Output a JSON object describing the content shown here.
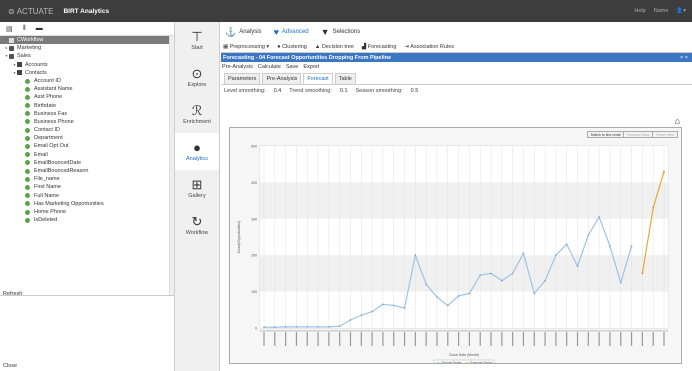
{
  "app": {
    "logo": "ACTUATE",
    "title": "BIRT Analytics",
    "help": "Help",
    "user": "Name"
  },
  "tree": [
    {
      "label": "CWorkflow",
      "level": 0,
      "type": "root",
      "selected": true
    },
    {
      "label": "Marketing",
      "level": 0,
      "type": "db"
    },
    {
      "label": "Sales",
      "level": 0,
      "type": "db"
    },
    {
      "label": "Accounts",
      "level": 1,
      "type": "table"
    },
    {
      "label": "Contacts",
      "level": 1,
      "type": "table"
    },
    {
      "label": "Account ID",
      "level": 2,
      "type": "field"
    },
    {
      "label": "Assistant Name",
      "level": 2,
      "type": "field"
    },
    {
      "label": "Asst Phone",
      "level": 2,
      "type": "field"
    },
    {
      "label": "Birthdate",
      "level": 2,
      "type": "field"
    },
    {
      "label": "Business Fax",
      "level": 2,
      "type": "field"
    },
    {
      "label": "Business Phone",
      "level": 2,
      "type": "field"
    },
    {
      "label": "Contact ID",
      "level": 2,
      "type": "field"
    },
    {
      "label": "Department",
      "level": 2,
      "type": "field"
    },
    {
      "label": "Email Opt Out",
      "level": 2,
      "type": "field"
    },
    {
      "label": "Email",
      "level": 2,
      "type": "field"
    },
    {
      "label": "EmailBouncedDate",
      "level": 2,
      "type": "field"
    },
    {
      "label": "EmailBouncedReason",
      "level": 2,
      "type": "field"
    },
    {
      "label": "File_name",
      "level": 2,
      "type": "field"
    },
    {
      "label": "First Name",
      "level": 2,
      "type": "field"
    },
    {
      "label": "Full Name",
      "level": 2,
      "type": "field"
    },
    {
      "label": "Has Marketing Opportunities",
      "level": 2,
      "type": "field"
    },
    {
      "label": "Home Phone",
      "level": 2,
      "type": "field"
    },
    {
      "label": "IsDeleted",
      "level": 2,
      "type": "field"
    }
  ],
  "left_footer": {
    "refresh": "Refresh",
    "close": "Close"
  },
  "nav": [
    {
      "label": "Start",
      "glyph": "⊤"
    },
    {
      "label": "Explore",
      "glyph": "⊙"
    },
    {
      "label": "Enrichment",
      "glyph": "ℛ"
    },
    {
      "label": "Analytics",
      "glyph": "●",
      "active": true
    },
    {
      "label": "Gallery",
      "glyph": "⊞"
    },
    {
      "label": "Workflow",
      "glyph": "↻"
    }
  ],
  "top_tabs": {
    "analysis": "Analysis",
    "advanced": "Advanced",
    "selections": "Selections"
  },
  "sub_tabs": {
    "preprocessing": "Preprocessing",
    "clustering": "Clustering",
    "decision_tree": "Decision tree",
    "forecasting": "Forecasting",
    "association": "Association Rules"
  },
  "panel_title": "Forecasting - 04 Forecast Opportunities Dropping From Pipeline",
  "panel_close": "× ×",
  "menu": {
    "preanalysis": "Pre-Analysis",
    "calculate": "Calculate",
    "save": "Save",
    "export": "Export"
  },
  "inner_tabs": {
    "parameters": "Parameters",
    "preanalysis": "Pre-Analysis",
    "forecast": "Forecast",
    "table": "Table"
  },
  "smoothing": {
    "level_label": "Level smoothing:",
    "level": "0.4",
    "trend_label": "Trend smoothing:",
    "trend": "0.1",
    "season_label": "Season smoothing:",
    "season": "0.5"
  },
  "chart_buttons": {
    "switch": "Switch to line mode",
    "forecast_data": "Forecast Data",
    "reset": "Reset View"
  },
  "chart_data": {
    "type": "line",
    "ylabel": "Count(Opportunities)",
    "xlabel": "Close Date (Month)",
    "ylim": [
      0,
      500
    ],
    "yticks": [
      0,
      100,
      200,
      300,
      400,
      500
    ],
    "series": [
      {
        "name": "Original Series",
        "color": "#9ec3e6",
        "values": [
          2,
          2,
          3,
          3,
          3,
          3,
          3,
          5,
          22,
          35,
          45,
          65,
          62,
          55,
          200,
          120,
          85,
          62,
          88,
          95,
          145,
          150,
          130,
          150,
          205,
          95,
          130,
          200,
          230,
          170,
          255,
          305,
          225,
          125,
          225
        ]
      },
      {
        "name": "Forecast Series",
        "color": "#e8a838",
        "values": [
          150,
          330,
          430
        ]
      }
    ],
    "legend": [
      "Original Series",
      "Forecast Series"
    ]
  }
}
